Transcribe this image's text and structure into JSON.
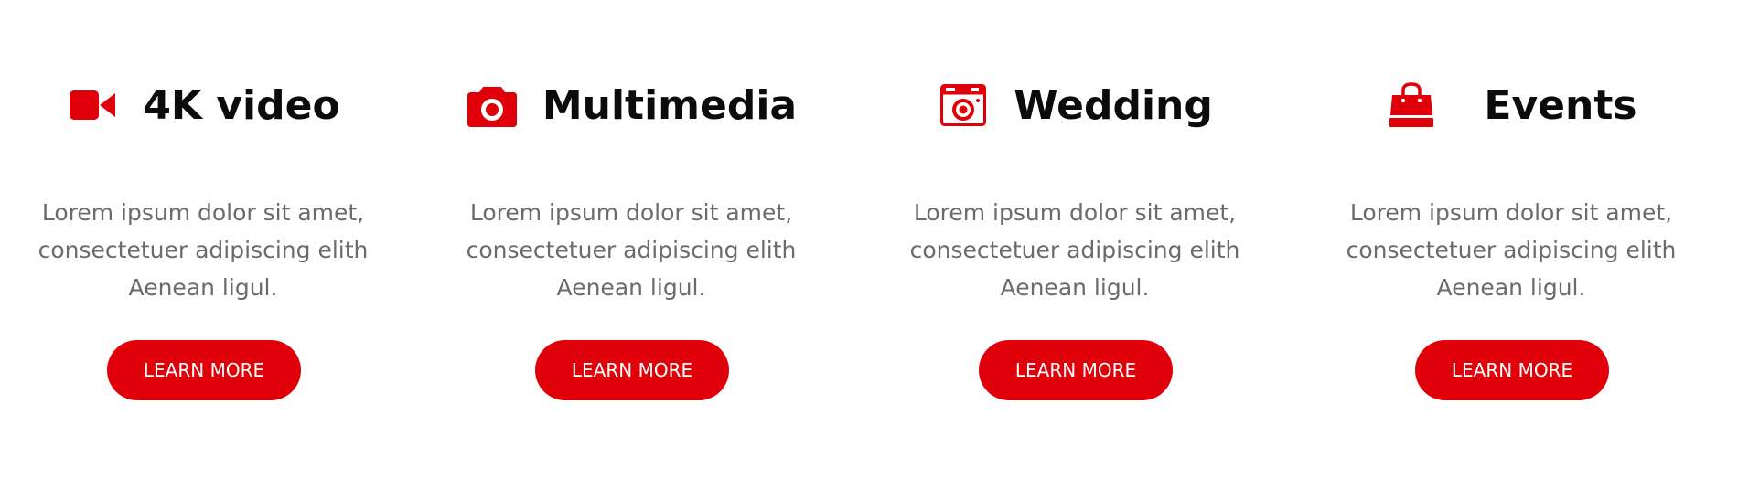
{
  "accent_color": "#e00009",
  "cards": [
    {
      "icon": "video-camera-icon",
      "title": "4K video",
      "description_lines": [
        "Lorem ipsum dolor sit amet,",
        "consectetuer adipiscing elith",
        "Aenean ligul."
      ],
      "button_label": "LEARN MORE"
    },
    {
      "icon": "camera-icon",
      "title": "Multimedia",
      "description_lines": [
        "Lorem ipsum dolor sit amet,",
        "consectetuer adipiscing elith",
        "Aenean ligul."
      ],
      "button_label": "LEARN MORE"
    },
    {
      "icon": "photo-camera-icon",
      "title": "Wedding",
      "description_lines": [
        "Lorem ipsum dolor sit amet,",
        "consectetuer adipiscing elith",
        "Aenean ligul."
      ],
      "button_label": "LEARN MORE"
    },
    {
      "icon": "shopping-bag-icon",
      "title": "Events",
      "description_lines": [
        "Lorem ipsum dolor sit amet,",
        "consectetuer adipiscing elith",
        "Aenean ligul."
      ],
      "button_label": "LEARN MORE"
    }
  ]
}
